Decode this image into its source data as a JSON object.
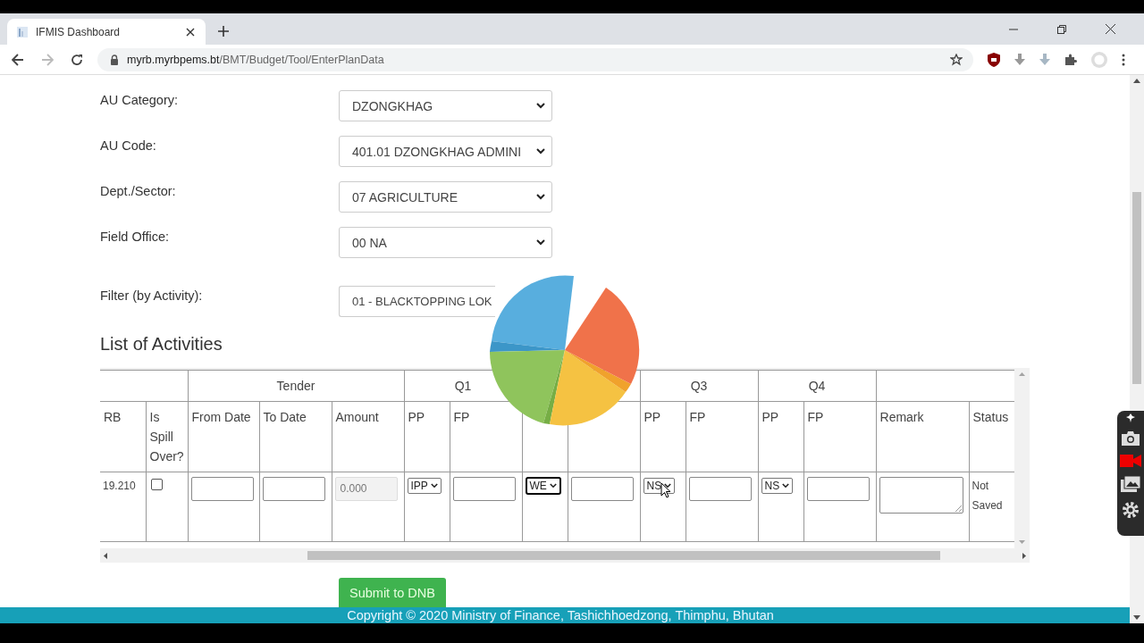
{
  "browser": {
    "tab_title": "IFMIS Dashboard",
    "url_host": "myrb.myrbpems.bt",
    "url_path": "/BMT/Budget/Tool/EnterPlanData"
  },
  "form": {
    "fields": [
      {
        "label": "AU Category:",
        "value": "DZONGKHAG"
      },
      {
        "label": "AU Code:",
        "value": "401.01 DZONGKHAG ADMINI"
      },
      {
        "label": "Dept./Sector:",
        "value": "07 AGRICULTURE"
      },
      {
        "label": "Field Office:",
        "value": "00 NA"
      }
    ],
    "filter": {
      "label": "Filter (by Activity):",
      "value": "01 - BLACKTOPPING LOK"
    }
  },
  "section_title": "List of Activities",
  "table": {
    "column_groups": [
      {
        "columns": [
          {
            "label": "RB"
          },
          {
            "label": "Is Spill Over?"
          }
        ]
      },
      {
        "label": "Tender",
        "columns": [
          {
            "label": "From Date"
          },
          {
            "label": "To Date"
          },
          {
            "label": "Amount"
          }
        ]
      },
      {
        "label": "Q1",
        "columns": [
          {
            "label": "PP"
          },
          {
            "label": "FP"
          }
        ]
      },
      {
        "columns": [
          {},
          {}
        ]
      },
      {
        "label": "Q3",
        "columns": [
          {
            "label": "PP"
          },
          {
            "label": "FP"
          }
        ]
      },
      {
        "label": "Q4",
        "columns": [
          {
            "label": "PP"
          },
          {
            "label": "FP"
          }
        ]
      },
      {
        "columns": [
          {
            "label": "Remark"
          },
          {
            "label": "Status"
          }
        ]
      }
    ],
    "rows": [
      {
        "cells": [
          {
            "kind": "text",
            "text": "19.210"
          },
          {
            "kind": "checkbox",
            "checked": false
          },
          {
            "kind": "input",
            "disabled": false
          },
          {
            "kind": "input",
            "disabled": false
          },
          {
            "kind": "input",
            "value": "0.000",
            "disabled": true
          },
          {
            "kind": "select",
            "value": "IPP",
            "focused": false
          },
          {
            "kind": "input",
            "disabled": false
          },
          {
            "kind": "select",
            "value": "WE",
            "focused": true
          },
          {
            "kind": "input",
            "disabled": false
          },
          {
            "kind": "select",
            "value": "NS",
            "focused": false
          },
          {
            "kind": "input",
            "disabled": false
          },
          {
            "kind": "select",
            "value": "NS",
            "focused": false
          },
          {
            "kind": "input",
            "disabled": false
          },
          {
            "kind": "textarea"
          },
          {
            "kind": "text",
            "text": "Not Saved"
          }
        ]
      }
    ]
  },
  "submit_button": "Submit to DNB",
  "footer": "Copyright © 2020 Ministry of Finance, Tashichhoedzong, Thimphu, Bhutan"
}
